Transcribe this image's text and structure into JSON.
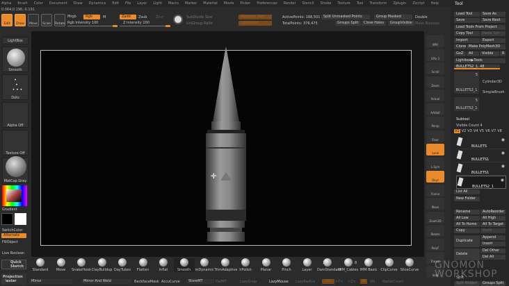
{
  "menu": [
    "Alpha",
    "Brush",
    "Color",
    "Document",
    "Draw",
    "Dynamics",
    "Edit",
    "File",
    "Layer",
    "Light",
    "Macro",
    "Marker",
    "Material",
    "Movie",
    "Picker",
    "Preferences",
    "Render",
    "Stencil",
    "Stroke",
    "Texture",
    "Tool",
    "Transform",
    "Zplugin",
    "Zscript",
    "Help"
  ],
  "coords": "0.064,0.196,-0.191",
  "toolbar": {
    "edit": "Edit",
    "draw": "Draw",
    "move": "Move",
    "scale": "Scale",
    "rotate": "Rotate",
    "mrgb": "Mrgb",
    "rgb": "Rgb",
    "m": "M",
    "rgb_intensity": "Rgb Intensity 100",
    "zadd": "Zadd",
    "zsub": "Zsub",
    "zcut": "Zcut",
    "z_intensity": "Z Intensity 100",
    "subdivide_size": "SubDivide Size",
    "unigroup_ratio": "UniGroup Ratio",
    "adaptive_size": "Adaptive Size",
    "combined": "Combined",
    "active_points": "ActivePoints: 168,501",
    "total_points": "TotalPoints: 376,475",
    "split_unmasked": "Split Unmasked Points",
    "group_masked": "Group Masked",
    "double": "Double",
    "groups_split": "Groups Split",
    "close_holes": "Close Holes",
    "group_visible": "GroupVisible",
    "make_boolean": "Make Boolean"
  },
  "left": {
    "lightbox": "LightBox",
    "smooth": "Smooth",
    "dots": "Dots",
    "alpha_off": "Alpha Off",
    "texture_off": "Texture Off",
    "matcap": "MatCap Gray",
    "gradient": "Gradient",
    "switch_color": "SwitchColor",
    "alternate": "Alternate",
    "fill_object": "FillObject",
    "live_boolean": "Live Boolean",
    "quick_sketch": "Quick Sketch",
    "projection_master": "Projection Master"
  },
  "shelf": [
    "BPR",
    "SPix 3",
    "Scroll",
    "Zoom",
    "Actual",
    "AAHalf",
    "Persp",
    "Floor",
    "Local",
    "L.Sym",
    "Qxyz",
    "Frame",
    "Move",
    "Zoom3D",
    "Rotate",
    "PolyF",
    "Transp",
    "Solo"
  ],
  "tool": {
    "title": "Tool",
    "load_tool": "Load Tool",
    "save_as": "Save As",
    "save": "Save",
    "save_next": "Save Next",
    "load_from_project": "Load Tools From Project",
    "copy_tool": "Copy Tool",
    "paste_tool": "Paste Tool",
    "import": "Import",
    "export": "Export",
    "clone": "Clone",
    "make_polymesh": "Make PolyMesh3D",
    "goz": "GoZ",
    "all": "All",
    "visible": "Visible",
    "r": "R",
    "lightbox_tools": "Lightbox▶Tools",
    "current_tool": "BULLETS2_1. 48",
    "thumb1": "BULLETS2_1",
    "thumb1_count": "5",
    "cylinder": "Cylinder3D",
    "simplebrush": "SimpleBrush",
    "thumb2": "BULLETS2_1",
    "thumb2_count": "5"
  },
  "subtool": {
    "title": "Subtool",
    "visible_count": "Visible Count 4",
    "tabs": [
      "V1",
      "V2",
      "V3",
      "V4",
      "V5",
      "V6",
      "V7",
      "V8"
    ],
    "items": [
      "BULLETS",
      "BULLETS1",
      "BULLETS1",
      "BULLETS2_1"
    ],
    "list_all": "List All",
    "new_folder": "New Folder",
    "rename": "Rename",
    "autoreorder": "AutoReorder",
    "all_low": "All Low",
    "all_high": "All High",
    "all_to_home": "All To Home",
    "all_to_target": "All To Target",
    "copy": "Copy",
    "paste": "Paste",
    "duplicate": "Duplicate",
    "append": "Append",
    "insert": "Insert",
    "delete": "Delete",
    "del_other": "Del Other",
    "del_all": "Del All",
    "split": "Split",
    "split_hidden": "Split Hidden",
    "groups_split": "Groups Split"
  },
  "brushes": [
    "Standard",
    "Move",
    "SnakeHook",
    "ClayBuildup",
    "DayTubes",
    "Flatten",
    "Inflat",
    "Smooth",
    "mDynamic",
    "TrimAdaptive",
    "hPolish",
    "Planar",
    "Pinch",
    "Layer",
    "DamStandard",
    "IMM_Cables",
    "IMM Basic",
    "ClipCurve",
    "SliceCurve"
  ],
  "imm_cables_count": "20",
  "imm_basic_count": "8",
  "bottom": {
    "mirror": "Mirror",
    "mirror_weld": "Mirror And Weld",
    "backface": "BackfaceMask",
    "accucurve": "AccuCurve",
    "storemt": "StoreMT",
    "delmt": "DelMT",
    "lazysnap": "LazySnap",
    "lazymouse": "LazyMouse",
    "lazyradius": "LazyRadius",
    "x": ">X<",
    "y": ">Y<",
    "z": ">Z<",
    "m": "M",
    "r": "(R)",
    "radial": "RadialCount"
  },
  "watermark": "GNOMON WORKSHOP",
  "colors": {
    "accent": "#e98a2c"
  }
}
